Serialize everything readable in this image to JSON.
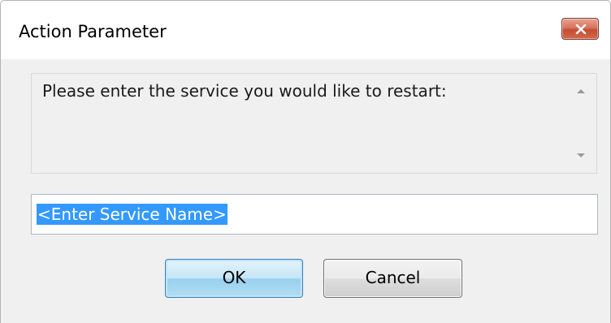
{
  "window": {
    "title": "Action Parameter"
  },
  "icons": {
    "close": "close-icon",
    "scroll_up": "scroll-up-arrow-icon",
    "scroll_down": "scroll-down-arrow-icon"
  },
  "message": {
    "text": "Please enter the service you would like to restart:"
  },
  "service_input": {
    "value": "<Enter Service Name>"
  },
  "buttons": {
    "ok_label": "OK",
    "cancel_label": "Cancel"
  },
  "colors": {
    "selection": "#3399ff",
    "close_button": "#c44d32",
    "default_button_border": "#3c7fb1"
  }
}
